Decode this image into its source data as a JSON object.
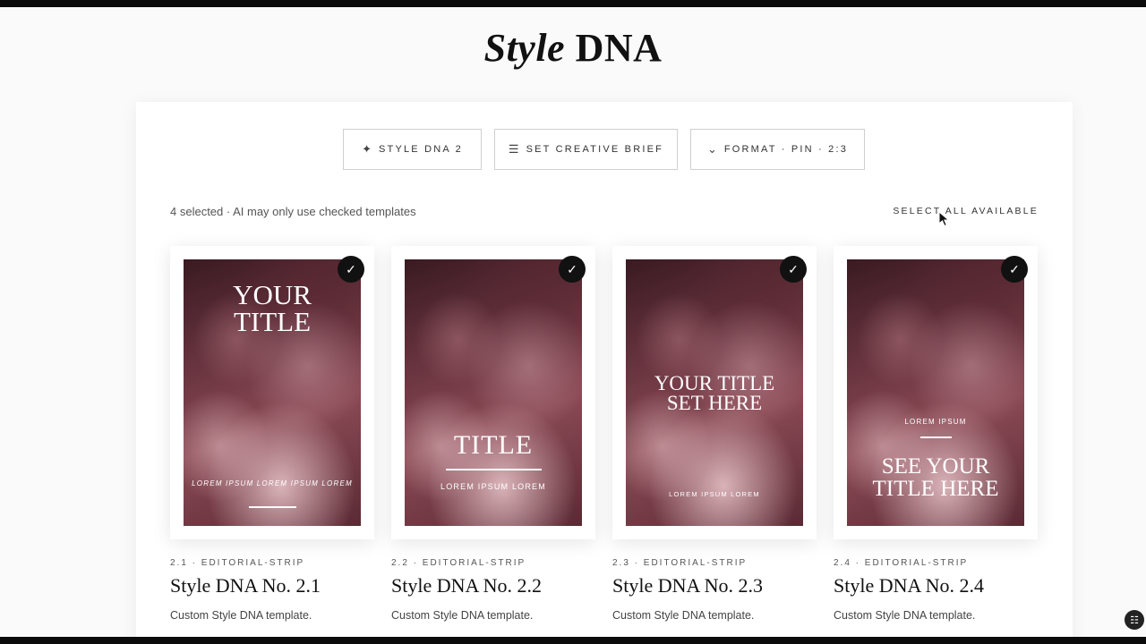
{
  "page": {
    "title_italic": "Style",
    "title_rest": " DNA"
  },
  "toolbar": {
    "style_dna_label": "STYLE DNA 2",
    "style_dna_icon": "sparkles-icon",
    "brief_label": "SET CREATIVE BRIEF",
    "brief_icon": "sliders-icon",
    "format_label": "FORMAT · PIN · 2:3",
    "format_icon": "chevron-down-icon"
  },
  "selection": {
    "status": "4 selected · AI may only use checked templates",
    "select_all": "SELECT ALL AVAILABLE"
  },
  "cards": [
    {
      "meta": "2.1 · EDITORIAL-STRIP",
      "name": "Style DNA No. 2.1",
      "desc": "Custom Style DNA template.",
      "checked": true,
      "line1": "YOUR",
      "line2": "TITLE",
      "caption": "LOREM IPSUM LOREM IPSUM LOREM"
    },
    {
      "meta": "2.2 · EDITORIAL-STRIP",
      "name": "Style DNA No. 2.2",
      "desc": "Custom Style DNA template.",
      "checked": true,
      "line1": "TITLE",
      "caption": "LOREM IPSUM LOREM"
    },
    {
      "meta": "2.3 · EDITORIAL-STRIP",
      "name": "Style DNA No. 2.3",
      "desc": "Custom Style DNA template.",
      "checked": true,
      "line1": "YOUR TITLE",
      "line2": "SET HERE",
      "caption": "LOREM IPSUM LOREM"
    },
    {
      "meta": "2.4 · EDITORIAL-STRIP",
      "name": "Style DNA No. 2.4",
      "desc": "Custom Style DNA template.",
      "checked": true,
      "eyebrow": "LOREM IPSUM",
      "line1": "SEE YOUR",
      "line2": "TITLE HERE"
    }
  ],
  "colors": {
    "accent": "#111111",
    "background": "#fafafa",
    "image_tone": "#6a3540"
  }
}
